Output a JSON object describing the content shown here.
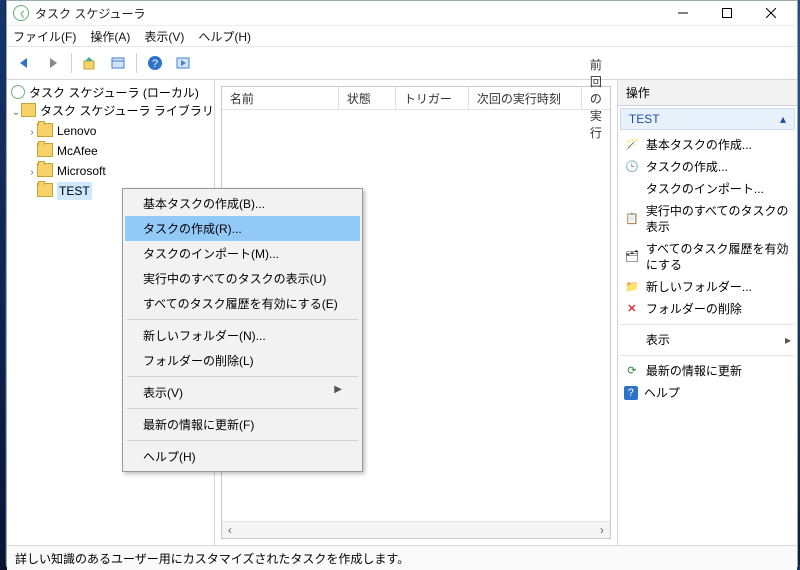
{
  "app": {
    "title": "タスク スケジューラ"
  },
  "menus": {
    "file": "ファイル(F)",
    "action": "操作(A)",
    "view": "表示(V)",
    "help": "ヘルプ(H)"
  },
  "tree": {
    "root": "タスク スケジューラ (ローカル)",
    "library": "タスク スケジューラ ライブラリ",
    "items": [
      "Lenovo",
      "McAfee",
      "Microsoft",
      "TEST"
    ]
  },
  "columns": {
    "name": "名前",
    "state": "状態",
    "trigger": "トリガー",
    "next": "次回の実行時刻",
    "last": "前回の実行"
  },
  "context": {
    "items": [
      "基本タスクの作成(B)...",
      "タスクの作成(R)...",
      "タスクのインポート(M)...",
      "実行中のすべてのタスクの表示(U)",
      "すべてのタスク履歴を有効にする(E)",
      "新しいフォルダー(N)...",
      "フォルダーの削除(L)",
      "表示(V)",
      "最新の情報に更新(F)",
      "ヘルプ(H)"
    ],
    "highlighted": 1
  },
  "actions": {
    "header": "操作",
    "target": "TEST",
    "items": [
      "基本タスクの作成...",
      "タスクの作成...",
      "タスクのインポート...",
      "実行中のすべてのタスクの表示",
      "すべてのタスク履歴を有効にする",
      "新しいフォルダー...",
      "フォルダーの削除",
      "表示",
      "最新の情報に更新",
      "ヘルプ"
    ]
  },
  "status": "詳しい知識のあるユーザー用にカスタマイズされたタスクを作成します。"
}
